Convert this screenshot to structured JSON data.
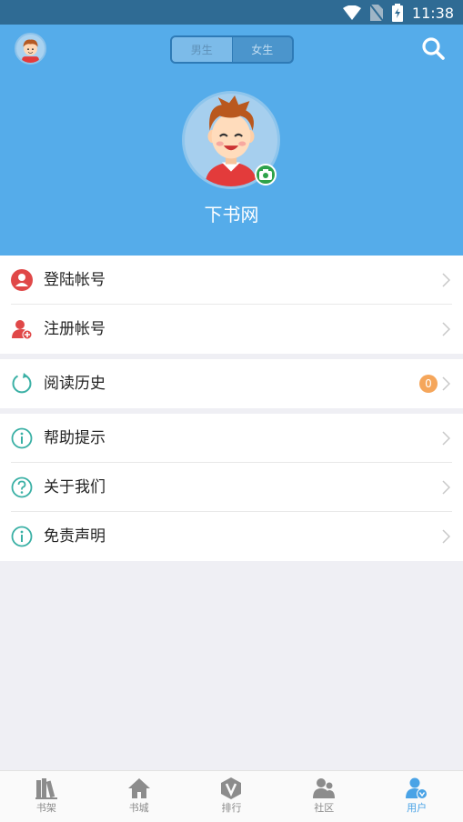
{
  "status_bar": {
    "time": "11:38"
  },
  "header": {
    "toggle": {
      "male_label": "男生",
      "female_label": "女生",
      "selected": "男生"
    },
    "username": "下书网"
  },
  "menu": {
    "account": [
      {
        "label": "登陆帐号",
        "icon": "user-circle-icon"
      },
      {
        "label": "注册帐号",
        "icon": "add-user-icon"
      }
    ],
    "history": {
      "label": "阅读历史",
      "icon": "refresh-icon",
      "badge": "0"
    },
    "info": [
      {
        "label": "帮助提示",
        "icon": "info-icon"
      },
      {
        "label": "关于我们",
        "icon": "question-icon"
      },
      {
        "label": "免责声明",
        "icon": "info-icon"
      }
    ]
  },
  "tabbar": {
    "tabs": [
      {
        "label": "书架",
        "icon": "bookshelf-icon"
      },
      {
        "label": "书城",
        "icon": "home-icon"
      },
      {
        "label": "排行",
        "icon": "ranking-icon"
      },
      {
        "label": "社区",
        "icon": "community-icon"
      },
      {
        "label": "用户",
        "icon": "user-icon"
      }
    ],
    "active": "用户"
  },
  "colors": {
    "header": "#55acea",
    "status_bar": "#2f6b94",
    "accent": "#4aa3e6",
    "badge": "#f5a65b"
  }
}
